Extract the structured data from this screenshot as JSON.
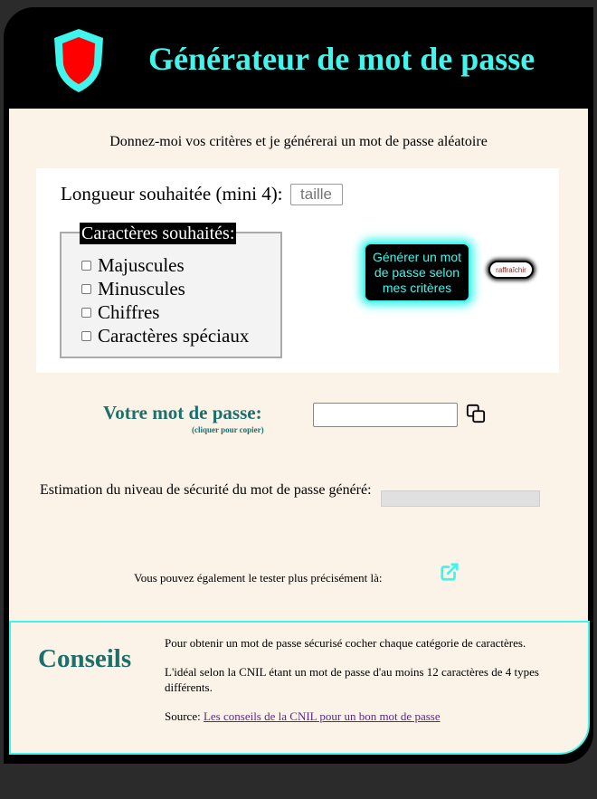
{
  "header": {
    "title": "Générateur de mot de passe",
    "logo_icon": "shield-icon",
    "logo_fill": "#ff0000",
    "logo_stroke": "#3ff5ec"
  },
  "intro": "Donnez-moi vos critères et je générerai un mot de passe aléatoire",
  "criteria": {
    "length_label": "Longueur souhaitée (mini 4):",
    "length_placeholder": "taille",
    "chars_legend": "Caractères souhaités:",
    "options": [
      {
        "label": "Majuscules",
        "checked": false
      },
      {
        "label": "Minuscules",
        "checked": false
      },
      {
        "label": "Chiffres",
        "checked": false
      },
      {
        "label": "Caractères spéciaux",
        "checked": false
      }
    ],
    "generate_button": "Générer un mot de passe selon mes critères",
    "refresh_button": "raffraîchir"
  },
  "password": {
    "label": "Votre mot de passe:",
    "hint": "(cliquer pour copier)",
    "value": "",
    "copy_icon": "copy-icon"
  },
  "estimation": {
    "label": "Estimation du niveau de sécurité du mot de passe généré:",
    "level": 0
  },
  "test": {
    "text": "Vous pouvez également le tester plus précisément là:",
    "link_icon": "external-link-icon"
  },
  "conseils": {
    "title": "Conseils",
    "paragraph1": "Pour obtenir un mot de passe sécurisé cocher chaque catégorie de caractères.",
    "paragraph2": "L'idéal selon la CNIL étant un mot de passe d'au moins 12 caractères de 4 types différents.",
    "source_label": "Source:",
    "source_link": "Les conseils de la CNIL pour un bon mot de passe"
  },
  "colors": {
    "accent": "#3ff5ec",
    "teal_text": "#1d6f6c",
    "page_bg": "#fbf3e8",
    "header_bg": "#000000"
  }
}
